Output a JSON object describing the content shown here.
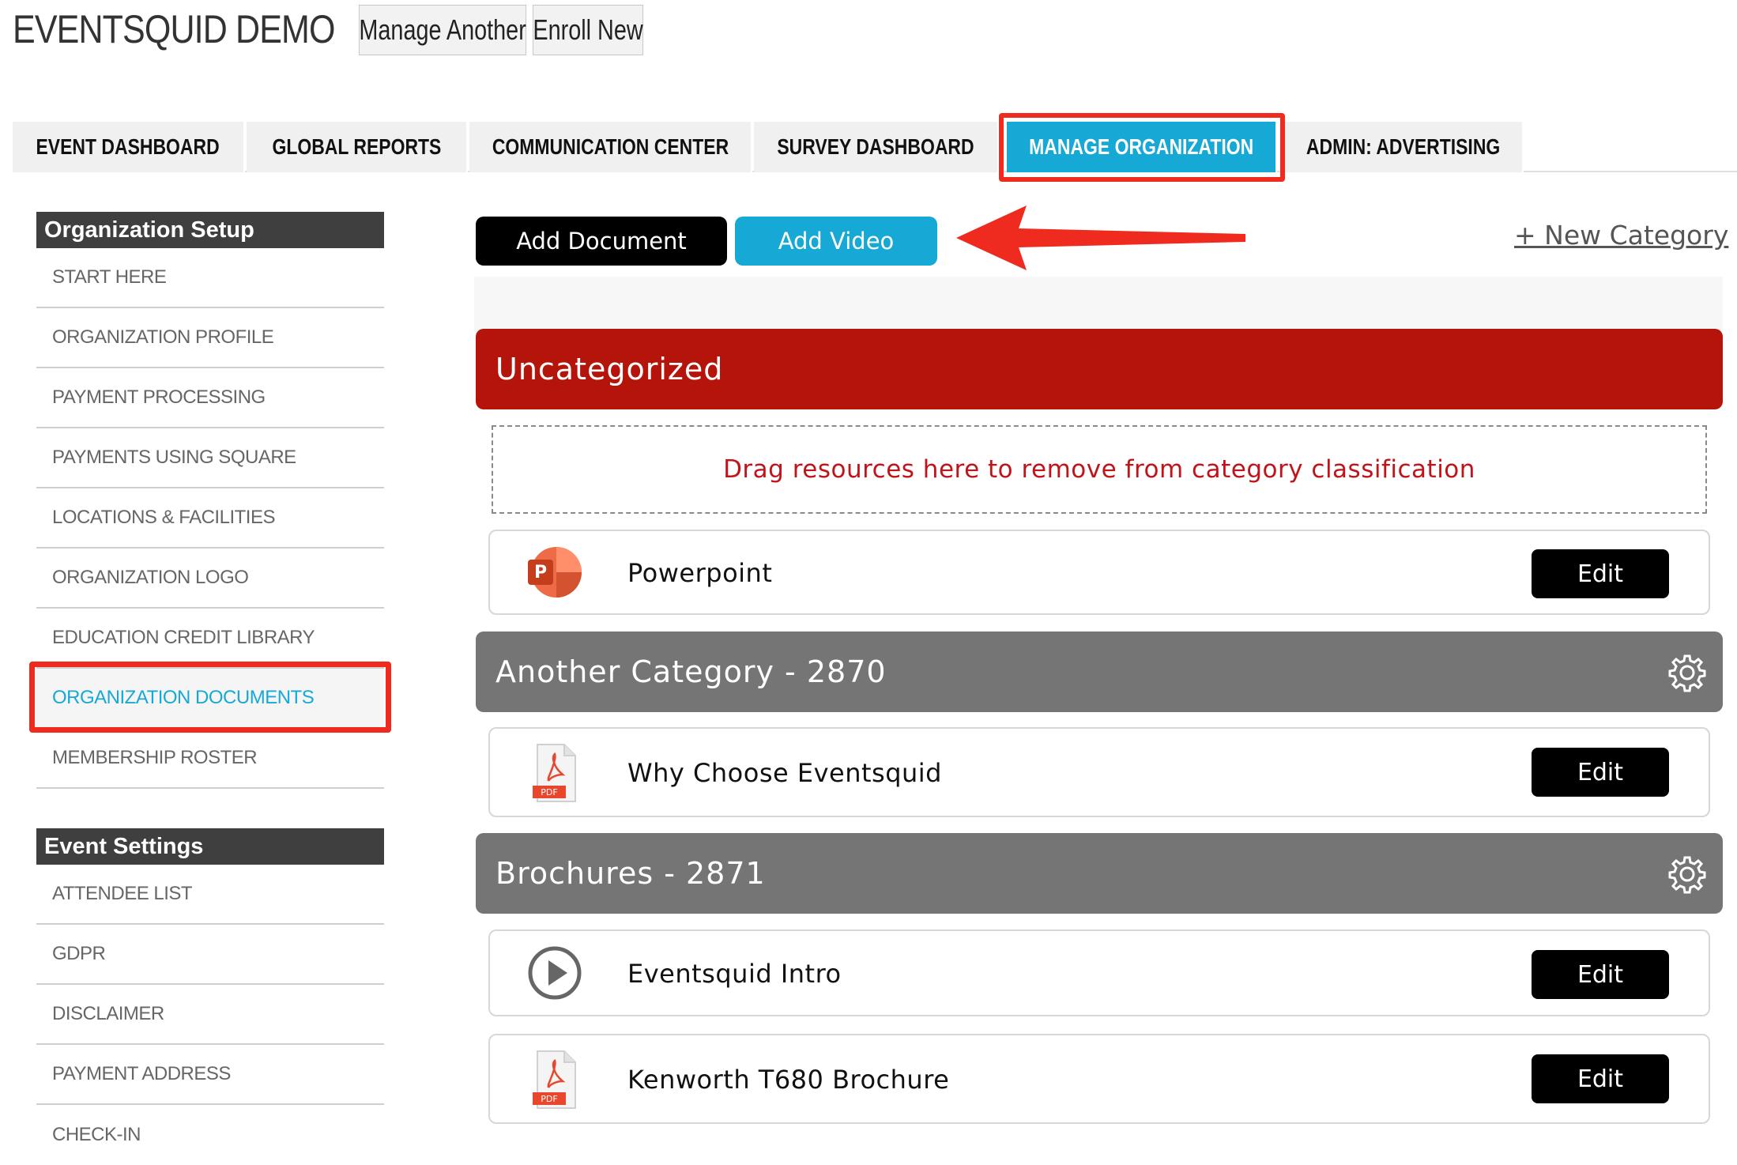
{
  "app": {
    "title": "EVENTSQUID DEMO"
  },
  "header_buttons": {
    "manage_another": "Manage Another",
    "enroll_new": "Enroll New"
  },
  "tabs": [
    {
      "label": "EVENT DASHBOARD",
      "active": false
    },
    {
      "label": "GLOBAL REPORTS",
      "active": false
    },
    {
      "label": "COMMUNICATION CENTER",
      "active": false
    },
    {
      "label": "SURVEY DASHBOARD",
      "active": false
    },
    {
      "label": "MANAGE ORGANIZATION",
      "active": true
    },
    {
      "label": "ADMIN: ADVERTISING",
      "active": false
    }
  ],
  "sidebar": {
    "org_setup": {
      "heading": "Organization Setup",
      "items": [
        "START HERE",
        "ORGANIZATION PROFILE",
        "PAYMENT PROCESSING",
        "PAYMENTS USING SQUARE",
        "LOCATIONS & FACILITIES",
        "ORGANIZATION LOGO",
        "EDUCATION CREDIT LIBRARY",
        "ORGANIZATION DOCUMENTS",
        "MEMBERSHIP ROSTER"
      ],
      "active_item": "ORGANIZATION DOCUMENTS"
    },
    "event_settings": {
      "heading": "Event Settings",
      "items": [
        "ATTENDEE LIST",
        "GDPR",
        "DISCLAIMER",
        "PAYMENT ADDRESS",
        "CHECK-IN"
      ]
    }
  },
  "actions": {
    "add_document": "Add Document",
    "add_video": "Add Video",
    "new_category": "+ New Category"
  },
  "categories": {
    "uncategorized": {
      "title": "Uncategorized",
      "drop_hint": "Drag resources here to remove from category classification",
      "resources": [
        {
          "name": "Powerpoint",
          "icon": "powerpoint-icon",
          "edit": "Edit"
        }
      ]
    },
    "another": {
      "title": "Another Category - 2870",
      "resources": [
        {
          "name": "Why Choose Eventsquid",
          "icon": "pdf-icon",
          "edit": "Edit"
        }
      ]
    },
    "brochures": {
      "title": "Brochures - 2871",
      "resources": [
        {
          "name": "Eventsquid Intro",
          "icon": "video-play-icon",
          "edit": "Edit"
        },
        {
          "name": "Kenworth T680 Brochure",
          "icon": "pdf-icon",
          "edit": "Edit"
        }
      ]
    }
  },
  "icon_labels": {
    "powerpoint": "P",
    "pdf": "PDF"
  },
  "colors": {
    "accent_blue": "#17a9d6",
    "highlight_red": "#ef2a1e",
    "category_red": "#b4140a",
    "category_gray": "#757575",
    "button_black": "#000000"
  }
}
